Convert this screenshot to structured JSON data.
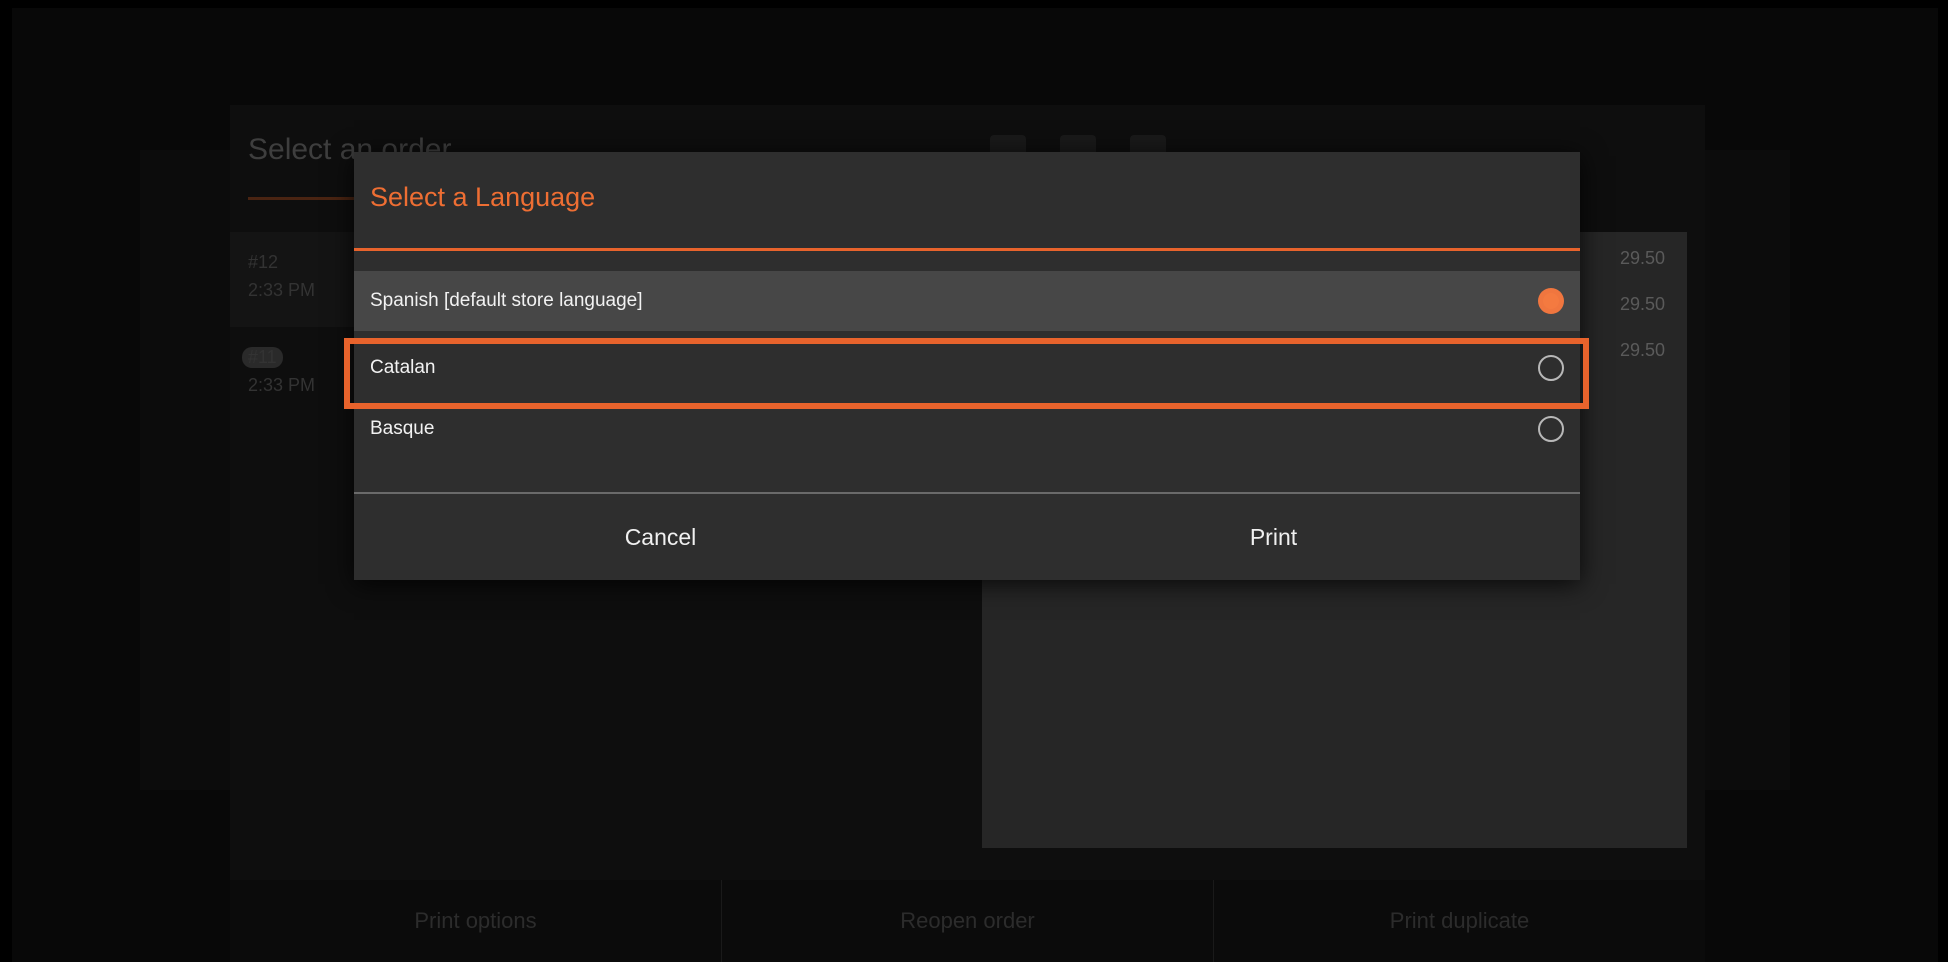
{
  "background": {
    "title": "Select an order",
    "orders": [
      {
        "number": "#12",
        "time": "2:33 PM"
      },
      {
        "number": "#11",
        "time": "2:33 PM"
      }
    ],
    "amounts": [
      "29.50",
      "29.50",
      "29.50"
    ],
    "bottom_buttons": [
      "Print options",
      "Reopen order",
      "Print duplicate"
    ]
  },
  "dialog": {
    "title": "Select a Language",
    "options": [
      {
        "label": "Spanish [default store language]",
        "checked": true
      },
      {
        "label": "Catalan",
        "checked": false
      },
      {
        "label": "Basque",
        "checked": false
      }
    ],
    "cancel_label": "Cancel",
    "print_label": "Print"
  },
  "colors": {
    "accent": "#e8632c",
    "dialog_bg": "#2e2e2e",
    "selected_row_bg": "#474747"
  }
}
